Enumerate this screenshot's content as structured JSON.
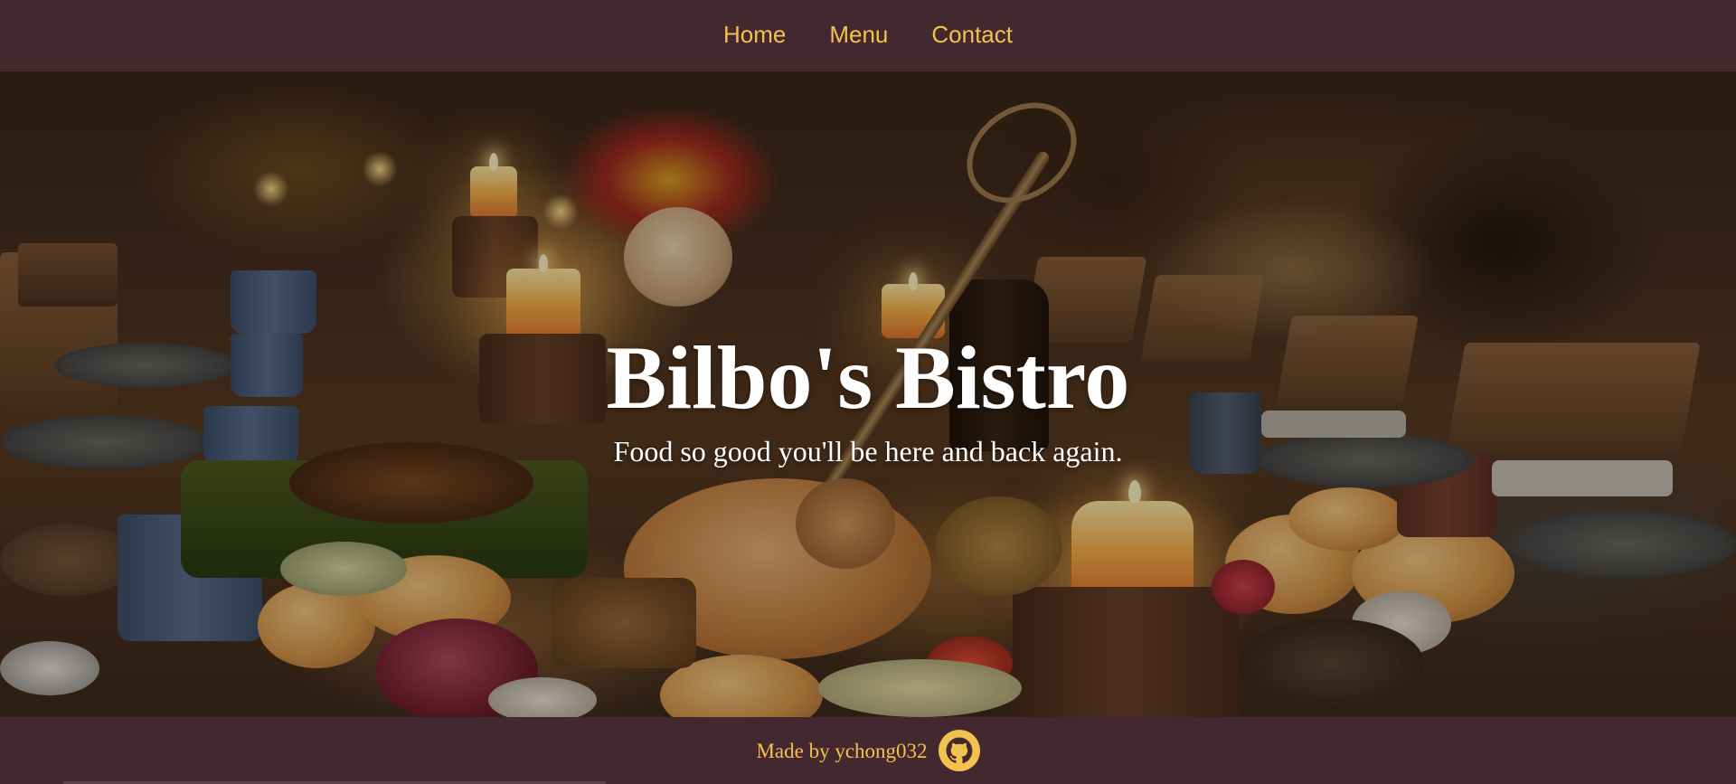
{
  "nav": {
    "links": [
      {
        "label": "Home"
      },
      {
        "label": "Menu"
      },
      {
        "label": "Contact"
      }
    ]
  },
  "hero": {
    "title": "Bilbo's Bistro",
    "subtitle": "Food so good you'll be here and back again."
  },
  "footer": {
    "credit": "Made by ychong032",
    "icon": "github-icon"
  },
  "colors": {
    "bar_background": "#432830",
    "accent": "#f2c14e",
    "hero_text": "#ffffff"
  }
}
